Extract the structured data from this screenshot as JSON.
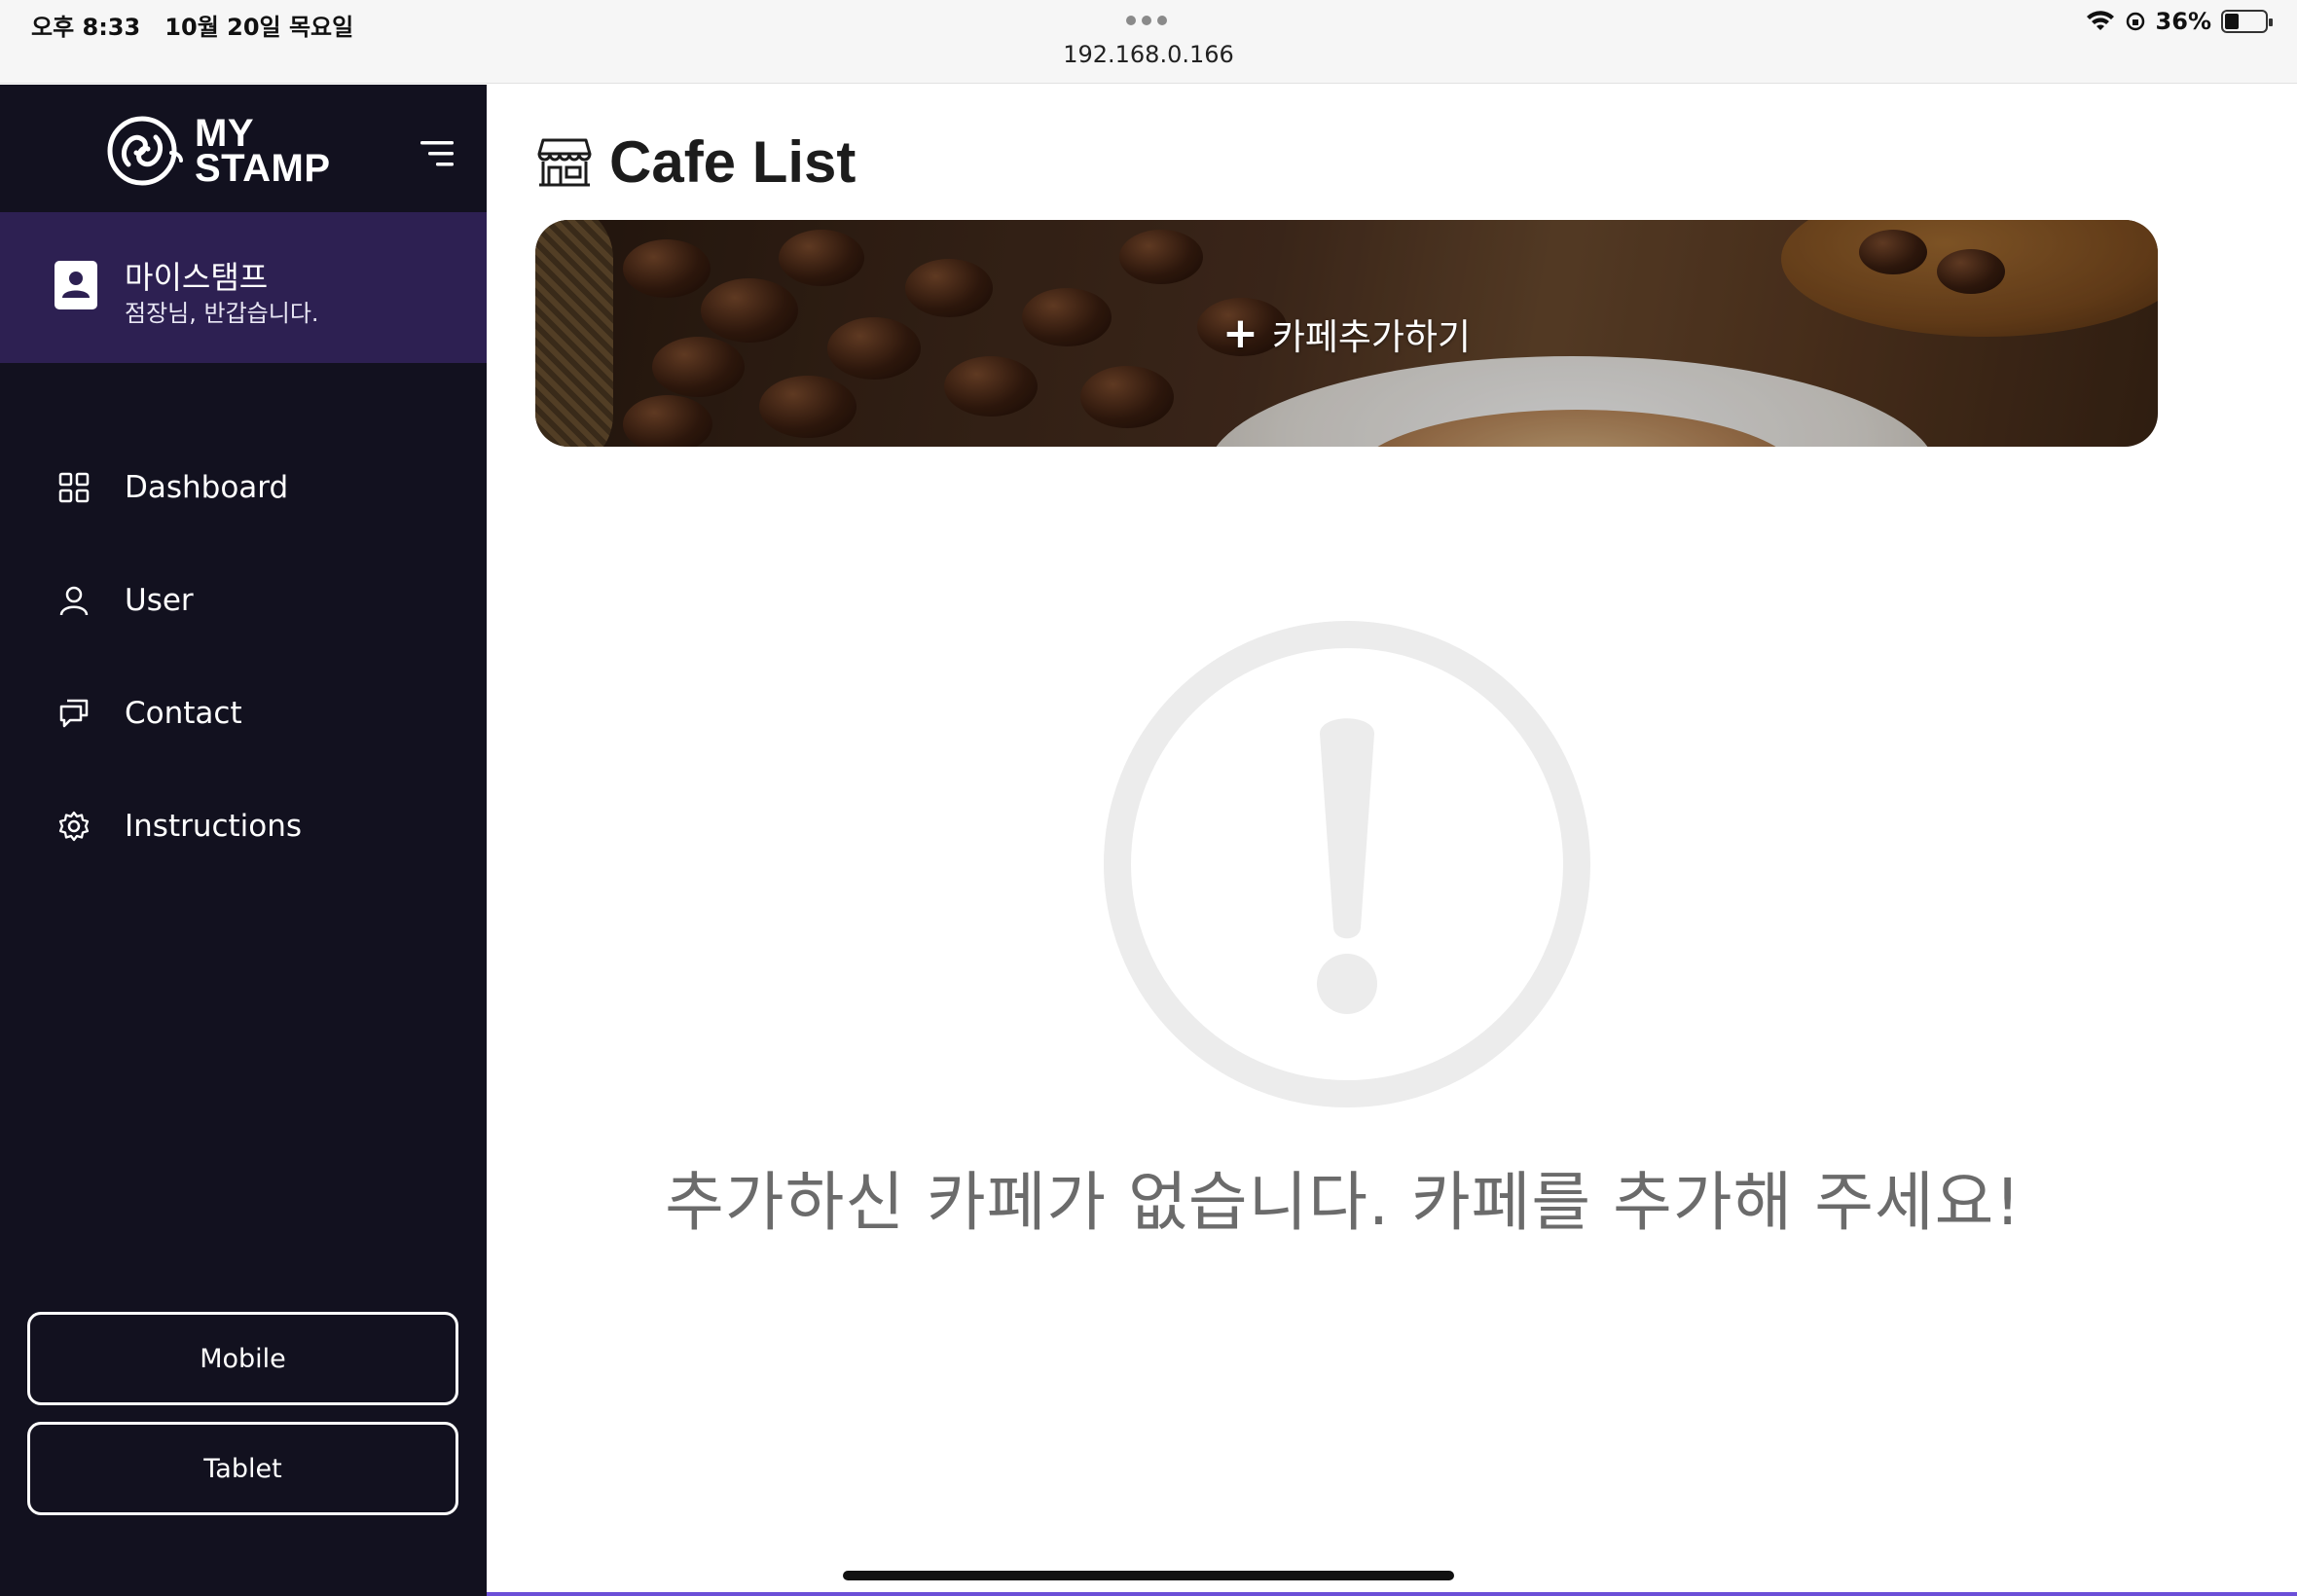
{
  "status_bar": {
    "time": "오후 8:33",
    "date": "10월 20일 목요일",
    "url": "192.168.0.166",
    "battery": "36%",
    "battery_level": 0.36,
    "icons": [
      "wifi-icon",
      "orientation-lock-icon",
      "battery-icon"
    ]
  },
  "sidebar": {
    "logo_line1": "MY",
    "logo_line2": "STAMP",
    "profile": {
      "name": "마이스탬프",
      "greeting": "점장님, 반갑습니다."
    },
    "nav": [
      {
        "label": "Dashboard",
        "icon": "dashboard-grid-icon"
      },
      {
        "label": "User",
        "icon": "user-icon"
      },
      {
        "label": "Contact",
        "icon": "chat-icon"
      },
      {
        "label": "Instructions",
        "icon": "gear-icon"
      }
    ],
    "buttons": {
      "mobile": "Mobile",
      "tablet": "Tablet"
    }
  },
  "main": {
    "title": "Cafe List",
    "title_icon": "store-icon",
    "banner_label": "카페추가하기",
    "banner_plus": "+",
    "empty_message": "추가하신 카페가 없습니다. 카페를 추가해 주세요!",
    "empty_icon": "exclamation-circle-icon"
  },
  "colors": {
    "sidebar_bg": "#12111f",
    "profile_bg": "#2d2052",
    "empty_icon": "#ececec",
    "empty_text": "#6b6b6b"
  }
}
